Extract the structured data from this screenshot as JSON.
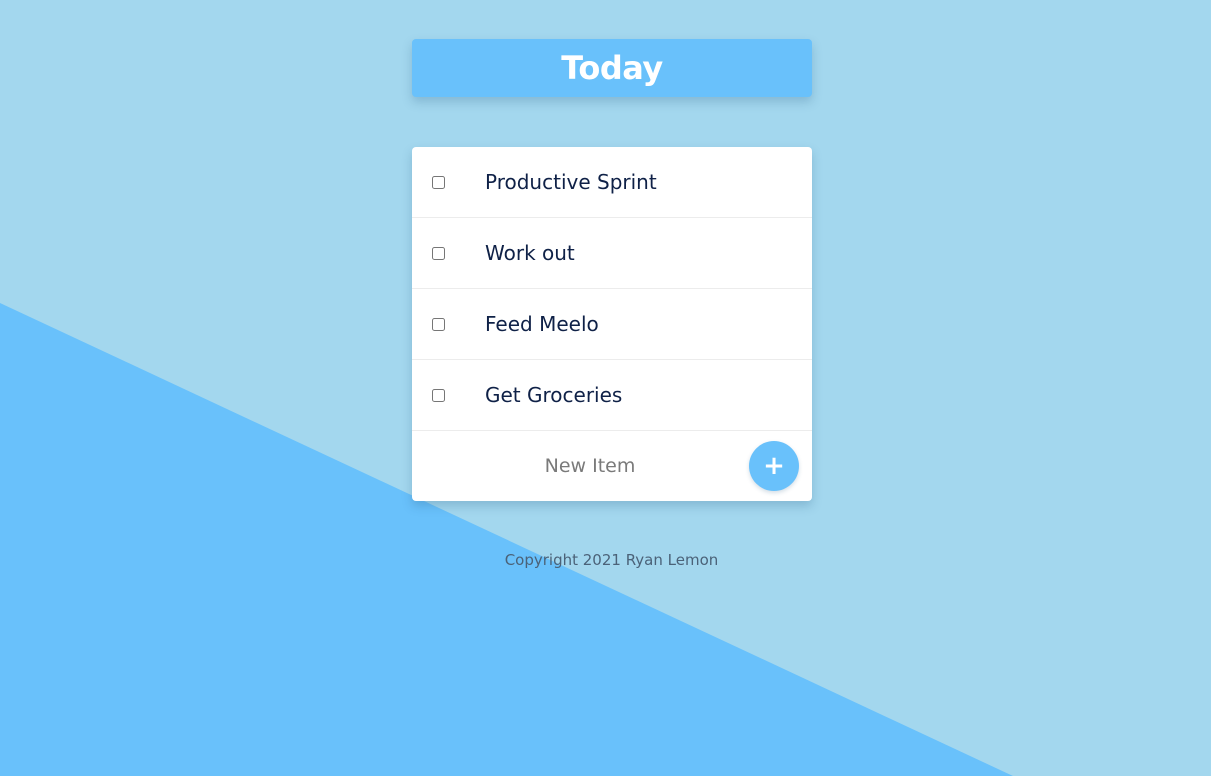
{
  "heading": {
    "title": "Today"
  },
  "list": {
    "items": [
      {
        "label": "Productive Sprint",
        "checked": false
      },
      {
        "label": "Work out",
        "checked": false
      },
      {
        "label": "Feed Meelo",
        "checked": false
      },
      {
        "label": "Get Groceries",
        "checked": false
      }
    ]
  },
  "new_item": {
    "placeholder": "New Item",
    "value": "",
    "add_icon": "plus-icon",
    "add_glyph": "+"
  },
  "footer": {
    "copyright": "Copyright 2021 Ryan Lemon"
  },
  "colors": {
    "background_light": "#a3d7ee",
    "background_accent": "#69c1fb",
    "heading_bg": "#69c1fb",
    "button_bg": "#69c1fb",
    "item_text": "#0f2147",
    "footer_text": "#4b6278"
  }
}
